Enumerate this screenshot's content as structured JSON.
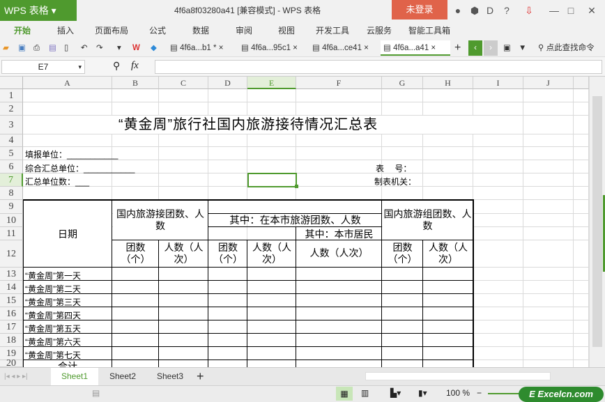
{
  "app": {
    "logo": "WPS 表格",
    "title": "4f6a8f03280a41 [兼容模式] - WPS 表格",
    "login": "未登录",
    "help": "?"
  },
  "menu": [
    "开始",
    "插入",
    "页面布局",
    "公式",
    "数据",
    "审阅",
    "视图",
    "开发工具",
    "云服务",
    "智能工具箱"
  ],
  "doc_tabs": [
    "4f6a...b1 *",
    "4f6a...95c1",
    "4f6a...ce41",
    "4f6a...a41"
  ],
  "search_cmd": "点此查找命令",
  "name_box": "E7",
  "fx_label": "fx",
  "formula": "",
  "columns": [
    "A",
    "B",
    "C",
    "D",
    "E",
    "F",
    "G",
    "H",
    "I",
    "J"
  ],
  "rows": [
    "1",
    "2",
    "3",
    "4",
    "5",
    "6",
    "7",
    "8",
    "9",
    "10",
    "11",
    "12",
    "13",
    "14",
    "15",
    "16",
    "17",
    "18",
    "19",
    "20"
  ],
  "sheet": {
    "title": "“黄金周”旅行社国内旅游接待情况汇总表",
    "fill_unit": "填报单位：___________",
    "summary_unit": "综合汇总单位：___________",
    "unit_count": "汇总单位数：___",
    "form_no": "表　 号：",
    "issuer": "制表机关：",
    "h_date": "日期",
    "h_receive": "国内旅游接团数、人数",
    "h_local": "其中：在本市旅游团数、人数",
    "h_resident": "其中：本市居民",
    "h_organize": "国内旅游组团数、人数",
    "h_groups": "团数（个）",
    "h_people": "人数（人次）",
    "h_people2": "人数（人次）",
    "days": [
      "“黄金周”第一天",
      "“黄金周”第二天",
      "“黄金周”第三天",
      "“黄金周”第四天",
      "“黄金周”第五天",
      "“黄金周”第六天",
      "“黄金周”第七天"
    ],
    "total": "合计"
  },
  "sheets": [
    "Sheet1",
    "Sheet2",
    "Sheet3"
  ],
  "active_sheet": "Sheet1",
  "zoom": "100 %",
  "watermark": "Excelcn.com",
  "colors": {
    "accent": "#4f9a2e",
    "login": "#e0634a"
  }
}
